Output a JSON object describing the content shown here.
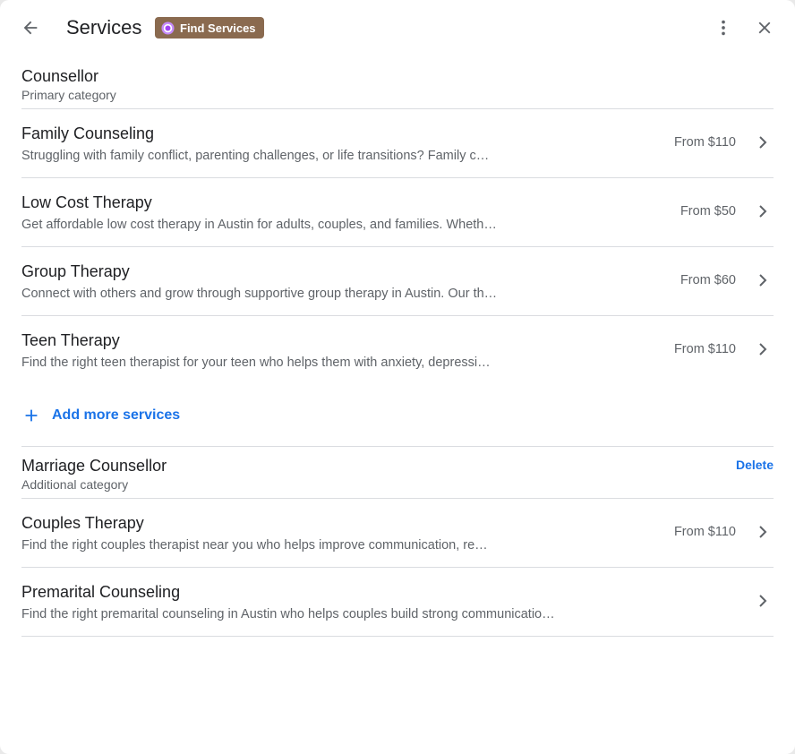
{
  "header": {
    "title": "Services",
    "badge_label": "Find Services",
    "back_icon": "arrow-back-icon",
    "more_icon": "more-vertical-icon",
    "close_icon": "close-icon"
  },
  "colors": {
    "accent": "#1a73e8",
    "badge_bg": "#8a6a4f",
    "divider": "#dadce0",
    "secondary_text": "#5f6368"
  },
  "primary_category": {
    "name": "Counsellor",
    "subtitle": "Primary category",
    "services": [
      {
        "name": "Family Counseling",
        "description": "Struggling with family conflict, parenting challenges, or life transitions? Family c…",
        "price": "From $110"
      },
      {
        "name": "Low Cost Therapy",
        "description": "Get affordable low cost therapy in Austin for adults, couples, and families. Wheth…",
        "price": "From $50"
      },
      {
        "name": "Group Therapy",
        "description": "Connect with others and grow through supportive group therapy in Austin. Our th…",
        "price": "From $60"
      },
      {
        "name": "Teen Therapy",
        "description": "Find the right teen therapist for your teen who helps them with anxiety, depressi…",
        "price": "From $110"
      }
    ],
    "add_more_label": "Add more services"
  },
  "additional_category": {
    "name": "Marriage Counsellor",
    "subtitle": "Additional category",
    "delete_label": "Delete",
    "services": [
      {
        "name": "Couples Therapy",
        "description": "Find the right couples therapist near you who helps improve communication, re…",
        "price": "From $110"
      },
      {
        "name": "Premarital Counseling",
        "description": "Find the right premarital counseling in Austin who helps couples build strong communicatio…",
        "price": ""
      }
    ]
  }
}
